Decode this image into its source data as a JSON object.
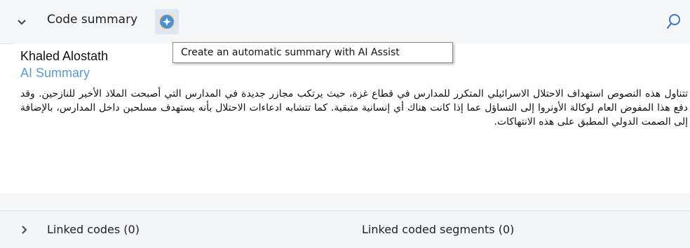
{
  "header": {
    "title": "Code summary",
    "expand_icon": "chevron-down-icon",
    "ai_icon": "ai-assist-icon",
    "search_icon": "search-icon"
  },
  "tooltip": {
    "text": "Create an automatic summary with AI Assist"
  },
  "summary": {
    "author": "Khaled Alostath",
    "label": "AI Summary",
    "text": "تتناول هذه النصوص استهداف الاحتلال الاسرائيلي المتكرر للمدارس في قطاع غزة، حيث يرتكب مجازر جديدة في المدارس التي أصبحت الملاذ الأخير للنازحين. وقد دفع هذا المفوض العام لوكالة الأونروا إلى التساؤل عما إذا كانت هناك أي إنسانية متبقية. كما تتشابه ادعاءات الاحتلال بأنه يستهدف مسلحين داخل المدارس، بالإضافة إلى الصمت الدولي المطبق على هذه الانتهاكات."
  },
  "footer": {
    "linked_codes": "Linked codes (0)",
    "linked_segments": "Linked coded segments (0)",
    "expand_icon": "chevron-right-icon"
  },
  "colors": {
    "ai_label": "#5b9bd5",
    "ai_icon": "#4a90d9",
    "search_icon": "#3b78c4"
  }
}
